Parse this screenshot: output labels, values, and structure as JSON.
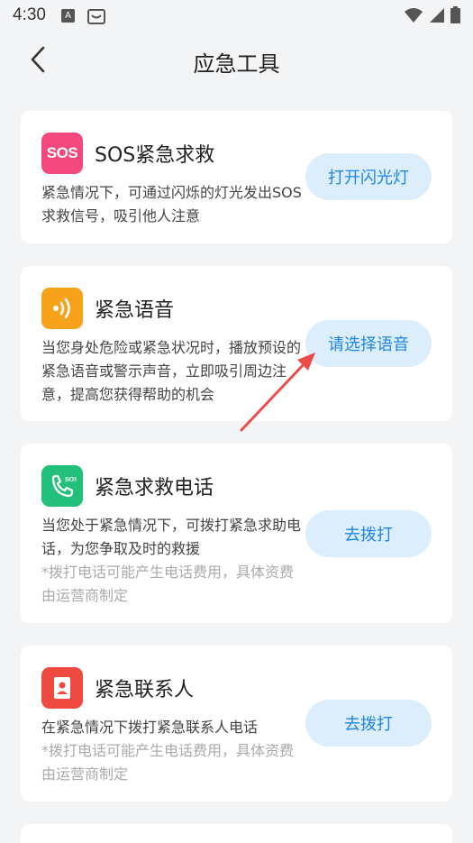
{
  "status_bar": {
    "time": "4:30",
    "icons": [
      "font-a-icon",
      "face-tray-icon",
      "wifi-icon",
      "signal-icon",
      "battery-icon"
    ]
  },
  "header": {
    "title": "应急工具",
    "back_icon": "chevron-left-icon"
  },
  "colors": {
    "accent": "#1e86e5",
    "button_bg": "#dcedfc",
    "sos_icon": "#f2487e",
    "voice_icon": "#f7a21b",
    "phone_icon": "#22c07a",
    "contact_icon": "#ef4a3f",
    "annotation_arrow": "#ee4b4b"
  },
  "tools": [
    {
      "title": "SOS紧急求救",
      "icon": "sos-icon",
      "desc": "紧急情况下，可通过闪烁的灯光发出SOS求救信号，吸引他人注意",
      "note": "",
      "button": "打开闪光灯"
    },
    {
      "title": "紧急语音",
      "icon": "sound-wave-icon",
      "desc": "当您身处危险或紧急状况时，播放预设的紧急语音或警示声音，立即吸引周边注意，提高您获得帮助的机会",
      "note": "",
      "button": "请选择语音"
    },
    {
      "title": "紧急求救电话",
      "icon": "phone-sos-icon",
      "desc": "当您处于紧急情况下，可拨打紧急求助电话，为您争取及时的救援",
      "note": "*拨打电话可能产生电话费用，具体资费由运营商制定",
      "button": "去拨打"
    },
    {
      "title": "紧急联系人",
      "icon": "contact-card-icon",
      "desc": "在紧急情况下拨打紧急联系人电话",
      "note": "*拨打电话可能产生电话费用，具体资费由运营商制定",
      "button": "去拨打"
    }
  ]
}
